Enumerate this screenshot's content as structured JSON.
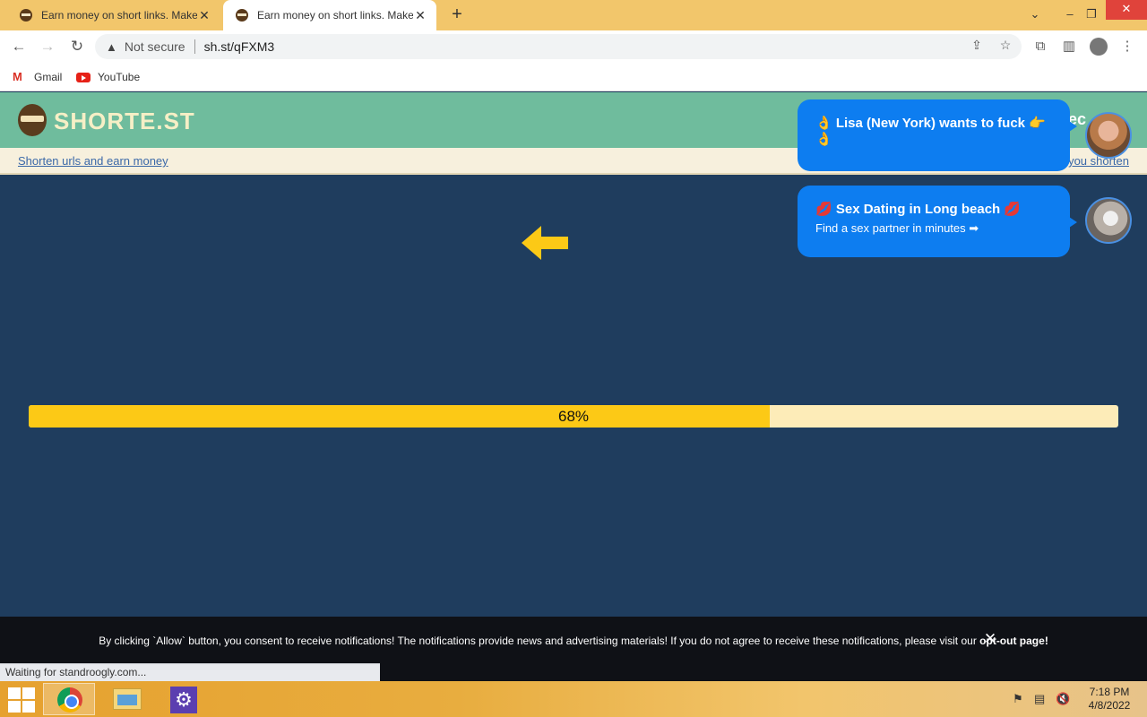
{
  "browser": {
    "tabs": [
      {
        "title": "Earn money on short links. Make",
        "active": false
      },
      {
        "title": "Earn money on short links. Make",
        "active": true
      }
    ],
    "address": {
      "security_label": "Not secure",
      "url": "sh.st/qFXM3"
    },
    "bookmarks": [
      {
        "label": "Gmail",
        "icon": "gmail-icon"
      },
      {
        "label": "YouTube",
        "icon": "youtube-icon"
      }
    ],
    "window_controls": {
      "minimize": "–",
      "maximize": "❐",
      "close": "✕"
    },
    "status_text": "Waiting for standroogly.com..."
  },
  "site": {
    "logo_text": "SHORTE.ST",
    "header_right_peek": "ec",
    "subbar_left": "Shorten urls and earn money",
    "subbar_right": "you shorten",
    "arrow_color": "#fcc916"
  },
  "progress": {
    "label": "68%",
    "value": 0.68,
    "fill_color": "#fcc916",
    "track_color": "#fdecb8"
  },
  "notifications": [
    {
      "title": "👌 Lisa (New York) wants to fuck 👉👌",
      "subtitle": ""
    },
    {
      "title": "💋 Sex Dating in Long beach 💋",
      "subtitle": "Find a sex partner in minutes ➡"
    }
  ],
  "consent": {
    "text_before": "By clicking `Allow` button, you consent to receive notifications! The notifications provide news and advertising materials! If you do not agree to receive these notifications, please visit our ",
    "link": "opt-out page",
    "text_after": "!",
    "close_label": "✕"
  },
  "taskbar": {
    "apps": [
      "chrome-icon",
      "file-explorer-icon",
      "control-panel-icon"
    ],
    "time": "7:18 PM",
    "date": "4/8/2022"
  }
}
